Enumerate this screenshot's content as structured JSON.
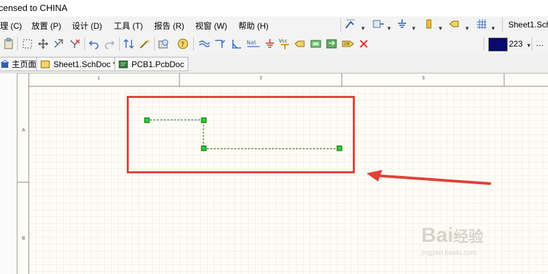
{
  "title_bar": {
    "text": "censed to CHINA"
  },
  "menu": {
    "items": [
      "理 (C)",
      "放置 (P)",
      "设计 (D)",
      "工具 (T)",
      "报告 (R)",
      "视窗 (W)",
      "帮助 (H)"
    ]
  },
  "toolbar": {
    "sheet_selector": "Sheet1.Sch",
    "color_value": "223",
    "more": "…",
    "color_swatch": "#0a0a6e"
  },
  "tabs": [
    {
      "label": "主页面"
    },
    {
      "label": "Sheet1.SchDoc *"
    },
    {
      "label": "PCB1.PcbDoc"
    }
  ],
  "sheet": {
    "col_labels": [
      "1",
      "2",
      "3"
    ],
    "row_labels": [
      "A",
      "B"
    ]
  },
  "watermark": {
    "brand": "Bai",
    "brand2": "经验",
    "url": "jingyan.baidu.com"
  },
  "colors": {
    "highlight": "#d9453c",
    "wire": "#1a5c1a",
    "node": "#2ecc2e",
    "grid": "#ece9dd"
  }
}
